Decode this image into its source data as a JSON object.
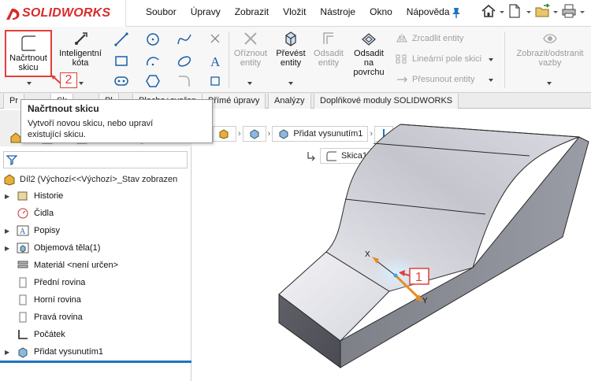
{
  "app": {
    "logo": "SOLIDWORKS"
  },
  "menu": [
    "Soubor",
    "Úpravy",
    "Zobrazit",
    "Vložit",
    "Nástroje",
    "Okno",
    "Nápověda"
  ],
  "ribbon": {
    "sketch_label_1": "Načrtnout",
    "sketch_label_2": "skicu",
    "dim_label_1": "Inteligentní",
    "dim_label_2": "kóta",
    "trim_label_1": "Oříznout",
    "trim_label_2": "entity",
    "convert_label_1": "Převést",
    "convert_label_2": "entity",
    "offset_label_1": "Odsadit",
    "offset_label_2": "entity",
    "offset_surface_1": "Odsadit",
    "offset_surface_2": "na",
    "offset_surface_3": "povrchu",
    "mirror": "Zrcadlit entity",
    "linear_pattern": "Lineární pole skici",
    "move": "Přesunout entity",
    "relations_1": "Zobrazit/odstranit",
    "relations_2": "vazby",
    "callout_2": "2"
  },
  "tabs": [
    "Prvky",
    "Skica",
    "Plechy",
    "Svařence",
    "Přímé úpravy",
    "Analýzy",
    "Doplňkové moduly SOLIDWORKS"
  ],
  "tabs_visible": {
    "t0": "Pr",
    "t1": "Sk",
    "t2": "Pl",
    "t3": "Plocha+svařen",
    "t4": "Přímé úpravy",
    "t5": "Analýzy",
    "t6": "Doplňkové moduly SOLIDWORKS"
  },
  "tooltip": {
    "title": "Načrtnout skicu",
    "body_1": "Vytvoří novou skicu, nebo upraví",
    "body_2": "existující skicu."
  },
  "tree": {
    "root": "Díl2  (Výchozí<<Výchozí>_Stav zobrazen",
    "items": [
      {
        "label": "Historie",
        "icon": "history-icon",
        "expand": true
      },
      {
        "label": "Čidla",
        "icon": "sensor-icon",
        "expand": false
      },
      {
        "label": "Popisy",
        "icon": "annotations-icon",
        "expand": true
      },
      {
        "label": "Objemová těla(1)",
        "icon": "solid-bodies-icon",
        "expand": true
      },
      {
        "label": "Materiál <není určen>",
        "icon": "material-icon",
        "expand": false
      },
      {
        "label": "Přední rovina",
        "icon": "plane-icon",
        "expand": false
      },
      {
        "label": "Horní rovina",
        "icon": "plane-icon",
        "expand": false
      },
      {
        "label": "Pravá rovina",
        "icon": "plane-icon",
        "expand": false
      },
      {
        "label": "Počátek",
        "icon": "origin-icon",
        "expand": false
      },
      {
        "label": "Přidat vysunutím1",
        "icon": "extrude-icon",
        "expand": true
      }
    ]
  },
  "breadcrumb": {
    "feature": "Přidat vysunutím1"
  },
  "sketch_tag": "Skica1",
  "viewport": {
    "axis_x": "X",
    "axis_y": "Y",
    "callout_1": "1"
  },
  "colors": {
    "accent": "#e0403a",
    "brand": "#d62b2b",
    "tree_bar": "#1e73be"
  }
}
